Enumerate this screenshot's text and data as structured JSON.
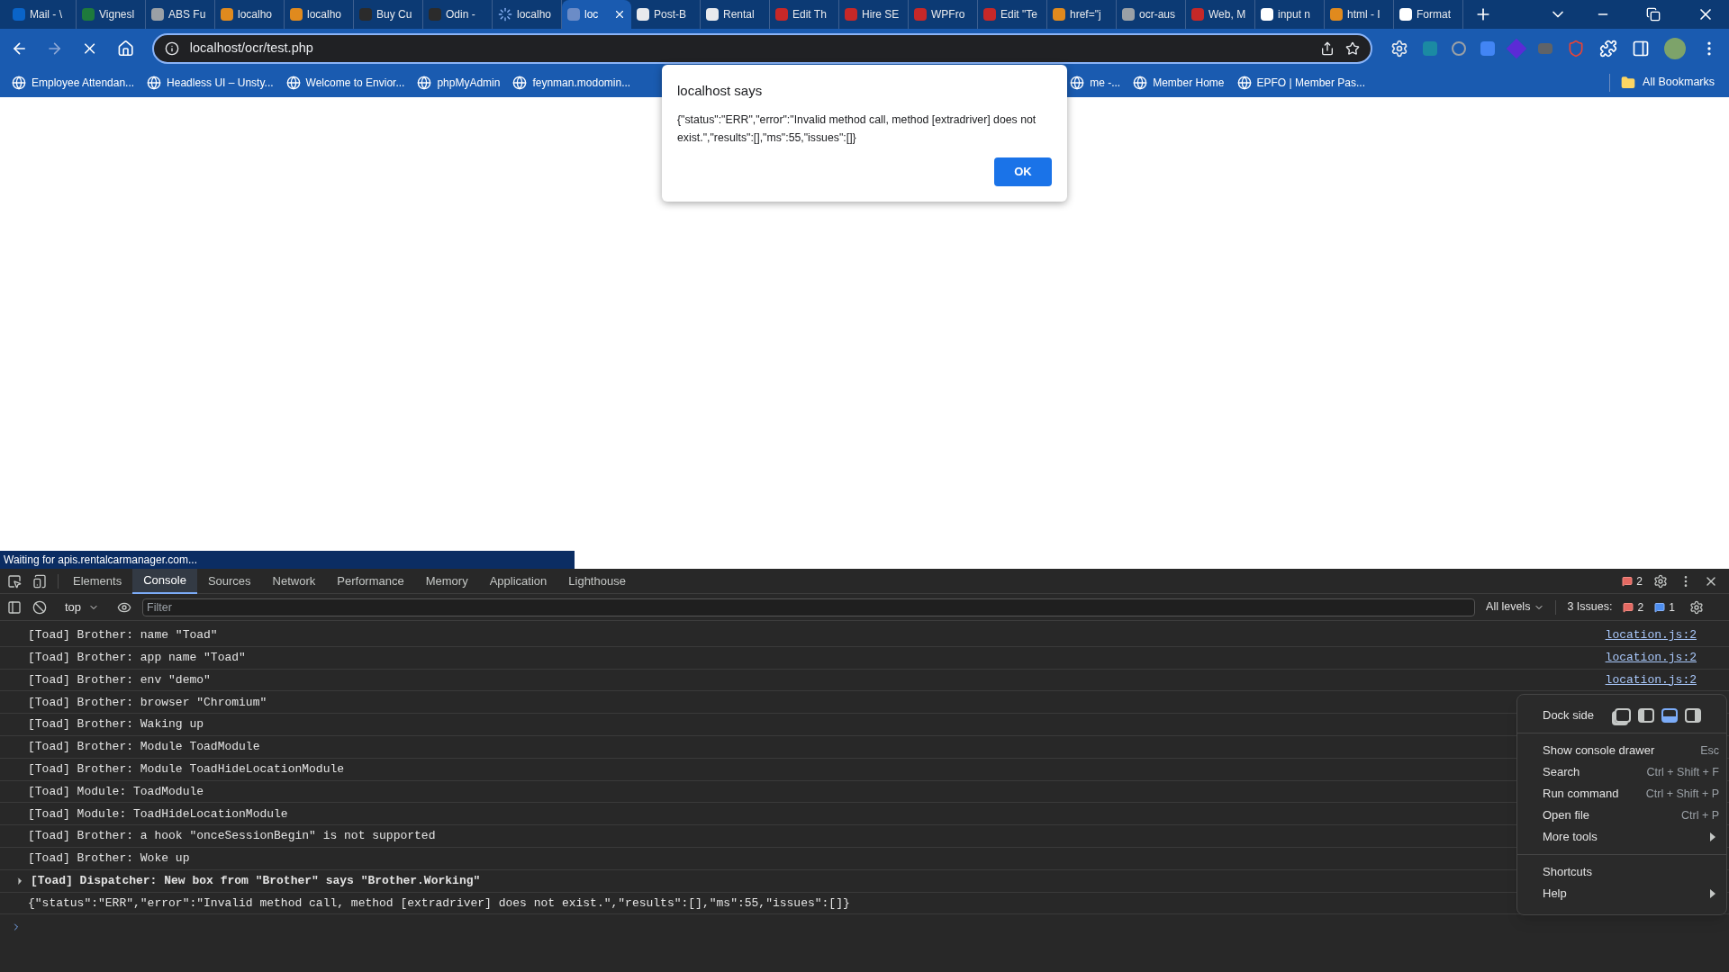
{
  "browser": {
    "tabs": [
      {
        "title": "Mail - \\",
        "selected": false,
        "loading": false
      },
      {
        "title": "Vignesl",
        "selected": false,
        "loading": false
      },
      {
        "title": "ABS Fu",
        "selected": false,
        "loading": false
      },
      {
        "title": "localho",
        "selected": false,
        "loading": false
      },
      {
        "title": "localho",
        "selected": false,
        "loading": false
      },
      {
        "title": "Buy Cu",
        "selected": false,
        "loading": false
      },
      {
        "title": "Odin -",
        "selected": false,
        "loading": false
      },
      {
        "title": "localho",
        "selected": false,
        "loading": true
      },
      {
        "title": "loc",
        "selected": true,
        "loading": false
      },
      {
        "title": "Post-B",
        "selected": false,
        "loading": false
      },
      {
        "title": "Rental",
        "selected": false,
        "loading": false
      },
      {
        "title": "Edit Th",
        "selected": false,
        "loading": false
      },
      {
        "title": "Hire SE",
        "selected": false,
        "loading": false
      },
      {
        "title": "WPFro",
        "selected": false,
        "loading": false
      },
      {
        "title": "Edit \"Te",
        "selected": false,
        "loading": false
      },
      {
        "title": "href=\"j",
        "selected": false,
        "loading": false
      },
      {
        "title": "ocr-aus",
        "selected": false,
        "loading": false
      },
      {
        "title": "Web, M",
        "selected": false,
        "loading": false
      },
      {
        "title": "input n",
        "selected": false,
        "loading": false
      },
      {
        "title": "html - I",
        "selected": false,
        "loading": false
      },
      {
        "title": "Format",
        "selected": false,
        "loading": false
      }
    ],
    "loading": true,
    "url": "localhost/ocr/test.php",
    "bookmarks_left": [
      "Employee Attendan...",
      "Headless UI – Unsty...",
      "Welcome to Envior...",
      "phpMyAdmin",
      "feynman.modomin..."
    ],
    "bookmarks_right": [
      "me -...",
      "Member Home",
      "EPFO | Member Pas..."
    ],
    "all_bookmarks": "All Bookmarks"
  },
  "dialog": {
    "title": "localhost says",
    "message": "{\"status\":\"ERR\",\"error\":\"Invalid method call, method [extradriver] does not exist.\",\"results\":[],\"ms\":55,\"issues\":[]}",
    "button": "OK"
  },
  "status_bubble": "Waiting for apis.rentalcarmanager.com...",
  "devtools": {
    "tabs": [
      {
        "label": "Elements",
        "selected": false
      },
      {
        "label": "Console",
        "selected": true
      },
      {
        "label": "Sources",
        "selected": false
      },
      {
        "label": "Network",
        "selected": false
      },
      {
        "label": "Performance",
        "selected": false
      },
      {
        "label": "Memory",
        "selected": false
      },
      {
        "label": "Application",
        "selected": false
      },
      {
        "label": "Lighthouse",
        "selected": false
      }
    ],
    "error_count": "2",
    "context": "top",
    "filter_placeholder": "Filter",
    "levels": "All levels",
    "issues_label": "3 Issues:",
    "issue_errors": "2",
    "issue_info": "1",
    "messages": [
      {
        "kind": "log",
        "text": "[Toad] Brother: name \"Toad\"",
        "source": "location.js:2"
      },
      {
        "kind": "log",
        "text": "[Toad] Brother: app name \"Toad\"",
        "source": "location.js:2"
      },
      {
        "kind": "log",
        "text": "[Toad] Brother: env \"demo\"",
        "source": "location.js:2"
      },
      {
        "kind": "log",
        "text": "[Toad] Brother: browser \"Chromium\""
      },
      {
        "kind": "log",
        "text": "[Toad] Brother: Waking up"
      },
      {
        "kind": "log",
        "text": "[Toad] Brother: Module ToadModule"
      },
      {
        "kind": "log",
        "text": "[Toad] Brother: Module ToadHideLocationModule"
      },
      {
        "kind": "log",
        "text": "[Toad] Module: ToadModule"
      },
      {
        "kind": "log",
        "text": "[Toad] Module: ToadHideLocationModule"
      },
      {
        "kind": "log",
        "text": "[Toad] Brother: a hook \"onceSessionBegin\" is not supported"
      },
      {
        "kind": "log",
        "text": "[Toad] Brother: Woke up"
      },
      {
        "kind": "group",
        "text": "[Toad] Dispatcher: New box from \"Brother\" says \"Brother.Working\"",
        "expanded": false
      },
      {
        "kind": "log",
        "text": "{\"status\":\"ERR\",\"error\":\"Invalid method call, method [extradriver] does not exist.\",\"results\":[],\"ms\":55,\"issues\":[]}"
      }
    ]
  },
  "menu": {
    "dock_label": "Dock side",
    "dock_options": [
      {
        "selected": false
      },
      {
        "selected": false
      },
      {
        "selected": true
      },
      {
        "selected": false
      }
    ],
    "sections": [
      [
        {
          "label": "Show console drawer",
          "shortcut": "Esc",
          "submenu": false
        },
        {
          "label": "Search",
          "shortcut": "Ctrl + Shift + F",
          "submenu": false
        },
        {
          "label": "Run command",
          "shortcut": "Ctrl + Shift + P",
          "submenu": false
        },
        {
          "label": "Open file",
          "shortcut": "Ctrl + P",
          "submenu": false
        },
        {
          "label": "More tools",
          "submenu": true
        }
      ],
      [
        {
          "label": "Shortcuts",
          "submenu": false
        },
        {
          "label": "Help",
          "submenu": true
        }
      ]
    ]
  }
}
